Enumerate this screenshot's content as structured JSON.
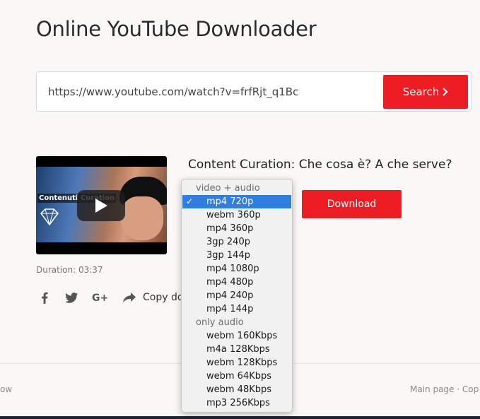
{
  "page_title": "Online YouTube Downloader",
  "search": {
    "value": "https://www.youtube.com/watch?v=frfRjt_q1Bc",
    "button_label": "Search"
  },
  "video": {
    "thumbnail_caption": "Contenuti Curation",
    "title": "Content Curation: Che cosa è? A che serve?",
    "duration": "Duration: 03:37"
  },
  "share": {
    "copy_label": "Copy dow"
  },
  "download_label": "Download",
  "format_dropdown": {
    "selected": "mp4 720p",
    "groups": [
      {
        "label": "video + audio",
        "options": [
          "mp4 720p",
          "webm 360p",
          "mp4 360p",
          "3gp 240p",
          "3gp 144p",
          "mp4 1080p",
          "mp4 480p",
          "mp4 240p",
          "mp4 144p"
        ]
      },
      {
        "label": "only audio",
        "options": [
          "webm 160Kbps",
          "m4a 128Kbps",
          "webm 128Kbps",
          "webm 64Kbps",
          "webm 48Kbps",
          "mp3 256Kbps"
        ]
      }
    ]
  },
  "footer": {
    "left_text": "ow",
    "right_text": "Main page  · Cop"
  },
  "colors": {
    "accent_red": "#ee1d24",
    "selection_blue": "#2f7ee0",
    "background": "#f9f8f7"
  }
}
